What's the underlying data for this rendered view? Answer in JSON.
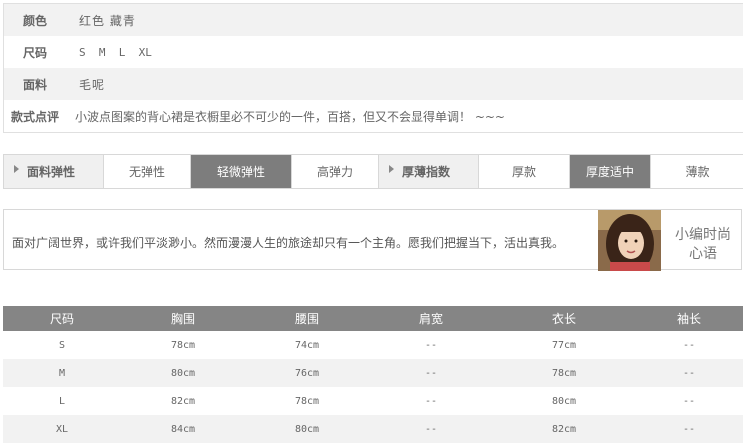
{
  "attributes": [
    {
      "label": "颜色",
      "value": "红色  藏青"
    },
    {
      "label": "尺码",
      "value": "S  M  L  XL"
    },
    {
      "label": "面料",
      "value": "毛呢"
    },
    {
      "label": "款式点评",
      "value": "小波点图案的背心裙是衣橱里必不可少的一件，百搭，但又不会显得单调！ ~~~"
    }
  ],
  "specbar": {
    "elasticity_title": "面料弹性",
    "elasticity_options": [
      "无弹性",
      "轻微弹性",
      "高弹力"
    ],
    "thickness_title": "厚薄指数",
    "thickness_options": [
      "厚款",
      "厚度适中",
      "薄款"
    ],
    "selected": [
      "轻微弹性",
      "厚度适中"
    ],
    "active_color": "#7d7d7d"
  },
  "note": {
    "text": "面对广阔世界，或许我们平淡渺小。然而漫漫人生的旅途却只有一个主角。愿我们把握当下，活出真我。",
    "title_line1": "小编时尚",
    "title_line2": "心语"
  },
  "size_table": {
    "headers": [
      "尺码",
      "胸围",
      "腰围",
      "肩宽",
      "衣长",
      "袖长"
    ],
    "rows": [
      [
        "S",
        "78cm",
        "74cm",
        "--",
        "77cm",
        "--"
      ],
      [
        "M",
        "80cm",
        "76cm",
        "--",
        "78cm",
        "--"
      ],
      [
        "L",
        "82cm",
        "78cm",
        "--",
        "80cm",
        "--"
      ],
      [
        "XL",
        "84cm",
        "80cm",
        "--",
        "82cm",
        "--"
      ]
    ],
    "header_color": "#858585"
  }
}
